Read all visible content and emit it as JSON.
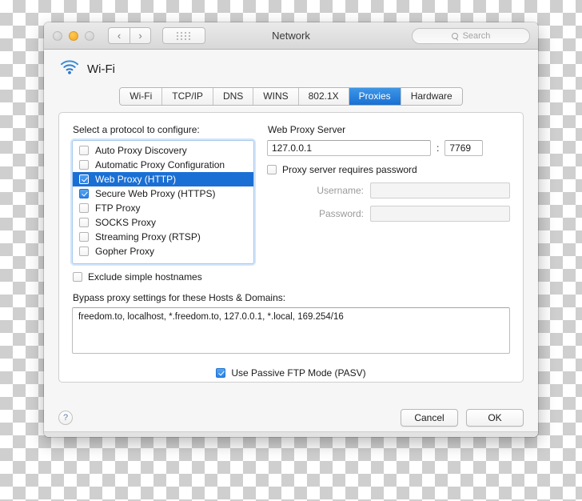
{
  "window": {
    "title": "Network",
    "traffic_lights": [
      "close-button",
      "minimize-button",
      "zoom-button"
    ],
    "nav_back": "‹",
    "nav_forward": "›",
    "show_all_icon": "grid-icon",
    "search": {
      "placeholder": "Search",
      "icon": "search-icon",
      "value": ""
    }
  },
  "service": {
    "icon": "wifi-icon",
    "name": "Wi-Fi"
  },
  "tabs": [
    {
      "label": "Wi-Fi",
      "active": false
    },
    {
      "label": "TCP/IP",
      "active": false
    },
    {
      "label": "DNS",
      "active": false
    },
    {
      "label": "WINS",
      "active": false
    },
    {
      "label": "802.1X",
      "active": false
    },
    {
      "label": "Proxies",
      "active": true
    },
    {
      "label": "Hardware",
      "active": false
    }
  ],
  "proxies": {
    "protocol_label": "Select a protocol to configure:",
    "protocols": [
      {
        "label": "Auto Proxy Discovery",
        "checked": false,
        "selected": false
      },
      {
        "label": "Automatic Proxy Configuration",
        "checked": false,
        "selected": false
      },
      {
        "label": "Web Proxy (HTTP)",
        "checked": true,
        "selected": true
      },
      {
        "label": "Secure Web Proxy (HTTPS)",
        "checked": true,
        "selected": false
      },
      {
        "label": "FTP Proxy",
        "checked": false,
        "selected": false
      },
      {
        "label": "SOCKS Proxy",
        "checked": false,
        "selected": false
      },
      {
        "label": "Streaming Proxy (RTSP)",
        "checked": false,
        "selected": false
      },
      {
        "label": "Gopher Proxy",
        "checked": false,
        "selected": false
      }
    ],
    "exclude_simple_hostnames": {
      "label": "Exclude simple hostnames",
      "checked": false
    },
    "server": {
      "title": "Web Proxy Server",
      "host": "127.0.0.1",
      "separator": ":",
      "port": "7769",
      "requires_password": {
        "label": "Proxy server requires password",
        "checked": false
      },
      "username_label": "Username:",
      "username_value": "",
      "password_label": "Password:",
      "password_value": ""
    },
    "bypass": {
      "label": "Bypass proxy settings for these Hosts & Domains:",
      "value": "freedom.to, localhost, *.freedom.to, 127.0.0.1, *.local, 169.254/16"
    },
    "passive_ftp": {
      "label": "Use Passive FTP Mode (PASV)",
      "checked": true
    }
  },
  "footer": {
    "help_label": "?",
    "cancel_label": "Cancel",
    "ok_label": "OK"
  },
  "colors": {
    "selection_blue": "#1a6fd4",
    "tab_active_blue": "#2f8fe8",
    "checkbox_blue": "#2b82e6",
    "wifi_icon_blue": "#2f7fd0",
    "window_bg": "#f6f6f6"
  }
}
